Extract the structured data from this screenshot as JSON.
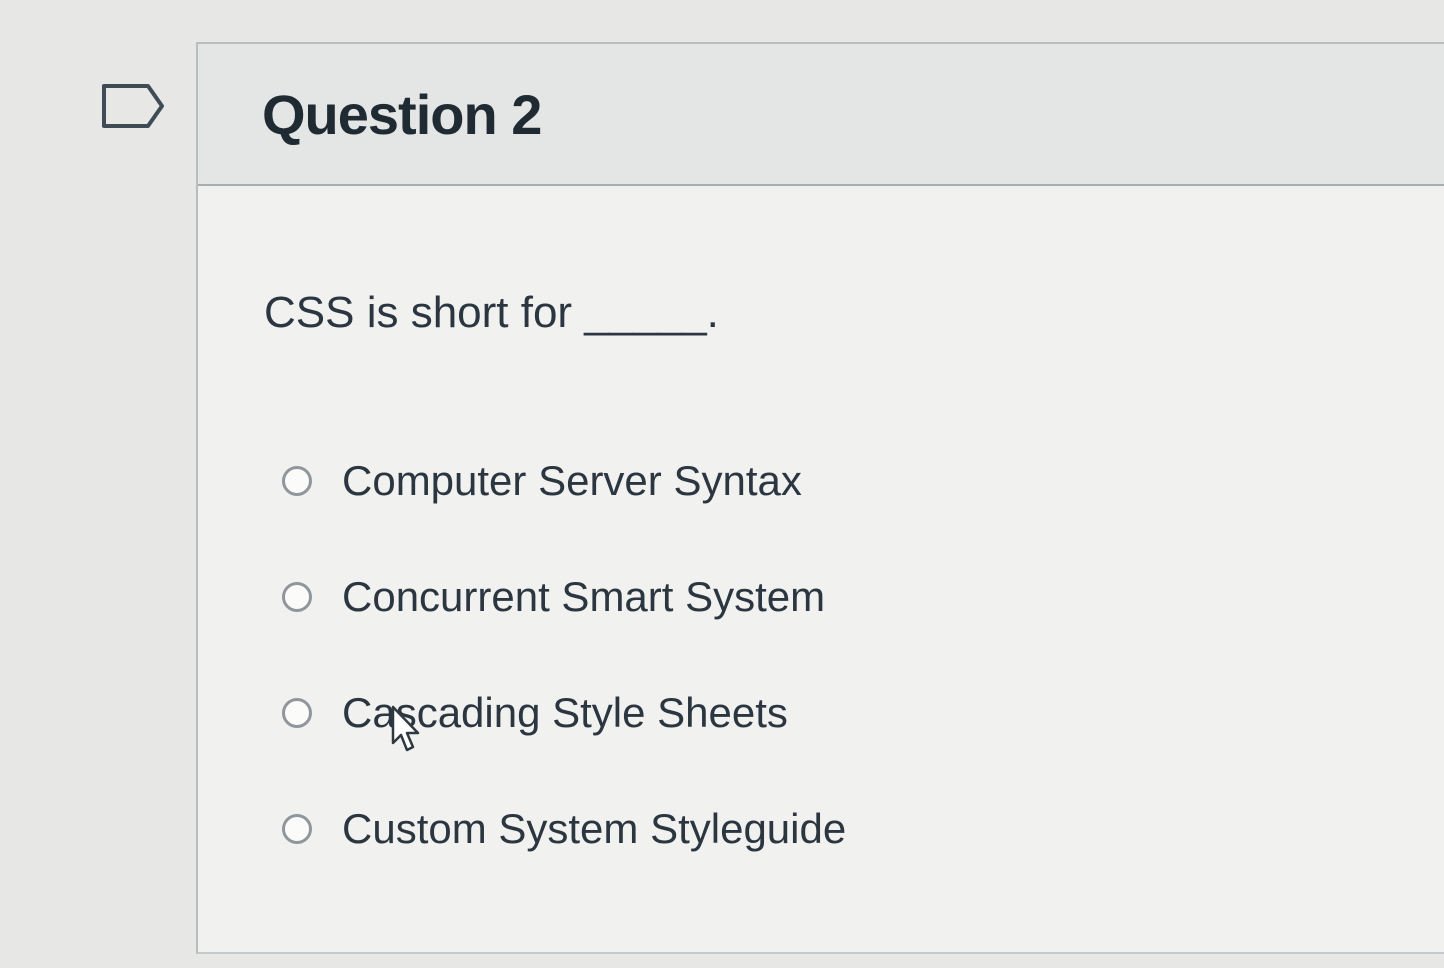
{
  "question": {
    "title": "Question 2",
    "text": "CSS is short for _____."
  },
  "answers": [
    {
      "label": "Computer Server Syntax",
      "selected": false
    },
    {
      "label": "Concurrent Smart System",
      "selected": false
    },
    {
      "label": "Cascading Style Sheets",
      "selected": false
    },
    {
      "label": "Custom System Styleguide",
      "selected": false
    }
  ],
  "icons": {
    "flag": "flag-outline-icon",
    "radio": "radio-unchecked-icon",
    "cursor": "mouse-pointer-icon"
  },
  "colors": {
    "text": "#2b3640",
    "header_background": "#e4e6e5",
    "card_background": "#f1f2f0",
    "radio_border": "#8f979c"
  }
}
